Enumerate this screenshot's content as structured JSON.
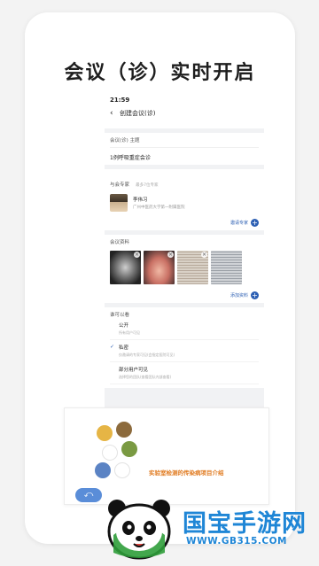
{
  "promo": {
    "title": "会议（诊）实时开启"
  },
  "status_bar": {
    "time": "21:59"
  },
  "nav": {
    "title": "创建会议(诊)"
  },
  "topic": {
    "label": "会议(诊) 主题",
    "value": "1例呼吸重症会诊"
  },
  "experts": {
    "label": "与会专家",
    "hint": "最多7位专家",
    "items": [
      {
        "name": "李伟习",
        "org": "广州中医药大学第一附属医院"
      }
    ],
    "invite_label": "邀请专家"
  },
  "materials": {
    "label": "会议资料",
    "thumbnails": [
      "xray-image",
      "tongue-image",
      "document-image",
      "document-image"
    ],
    "add_label": "添加资料"
  },
  "visibility": {
    "label": "谁可以看",
    "selected_index": 1,
    "options": [
      {
        "label": "公开",
        "desc": "所有用户可见"
      },
      {
        "label": "私密",
        "desc": "仅邀请的专家可见(会指定医院可见)"
      },
      {
        "label": "部分用户可见",
        "desc": "选择您的团队(查看团队内部查看)"
      }
    ]
  },
  "slide": {
    "caption": "实验室检测的传染病项目介绍"
  },
  "watermark": {
    "brand": "国宝手游网",
    "url": "WWW.GB315.COM"
  },
  "colors": {
    "accent": "#2c5fb3",
    "brand_blue": "#1f86d6",
    "orange": "#e07a1f"
  }
}
